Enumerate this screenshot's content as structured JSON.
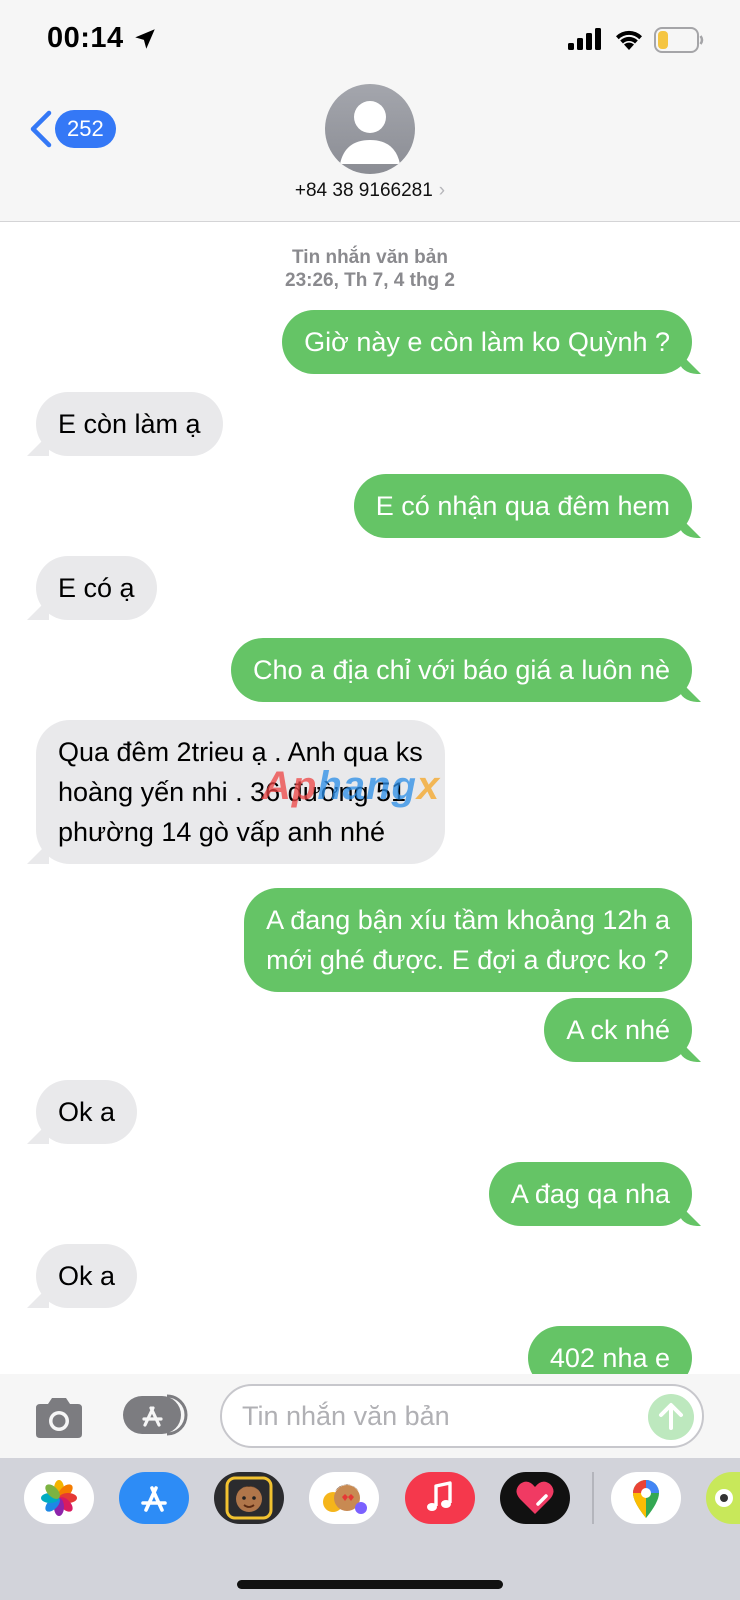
{
  "status_bar": {
    "time": "00:14",
    "icons": [
      "location-arrow-icon",
      "cellular-signal-icon",
      "wifi-icon",
      "battery-low-icon"
    ],
    "battery_color": "#f5c542"
  },
  "header": {
    "back_count": "252",
    "contact_name": "+84 38 9166281",
    "chevron": "›"
  },
  "thread": {
    "label": "Tin nhắn văn bản",
    "timestamp": "23:26, Th 7, 4 thg 2",
    "messages": [
      {
        "dir": "out",
        "text": "Giờ này e còn làm ko Quỳnh ?"
      },
      {
        "dir": "in",
        "text": "E còn làm ạ"
      },
      {
        "dir": "out",
        "text": "E có nhận qua đêm hem"
      },
      {
        "dir": "in",
        "text": "E có ạ"
      },
      {
        "dir": "out",
        "text": "Cho a địa chỉ với báo giá a luôn nè"
      },
      {
        "dir": "in",
        "lines": [
          "Qua đêm 2trieu ạ . Anh qua ks",
          "hoàng yến nhi . 36 đường 51",
          "phường 14 gò vấp anh nhé"
        ]
      },
      {
        "dir": "out",
        "lines": [
          "A đang bận xíu tầm khoảng 12h a",
          "mới ghé được. E đợi a được ko ?"
        ]
      },
      {
        "dir": "out",
        "text": "A ck nhé"
      },
      {
        "dir": "in",
        "text": "Ok a"
      },
      {
        "dir": "out",
        "text": "A đag qa nha"
      },
      {
        "dir": "in",
        "text": "Ok a"
      },
      {
        "dir": "out",
        "text": "402 nha e"
      }
    ],
    "watermark": [
      "Ap",
      "hang",
      "x"
    ]
  },
  "input": {
    "placeholder": "Tin nhắn văn bản"
  },
  "colors": {
    "outgoing": "#65c466",
    "incoming": "#e9e9eb",
    "accent": "#3478f6"
  },
  "drawer_apps": [
    "photos-icon",
    "app-store-icon",
    "memoji-icon",
    "animoji-icon",
    "music-icon",
    "digital-touch-icon",
    "maps-icon",
    "partial-app-icon"
  ]
}
